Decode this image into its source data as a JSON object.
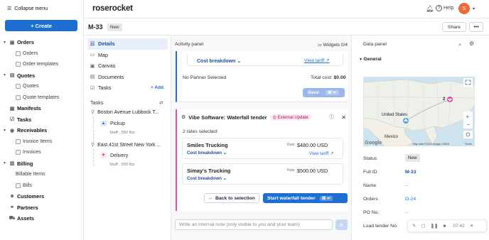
{
  "sidebar": {
    "collapse_label": "Collapse menu",
    "create_label": "+ Create",
    "groups": [
      {
        "label": "Orders",
        "items": [
          "Orders",
          "Order templates"
        ]
      },
      {
        "label": "Quotes",
        "items": [
          "Quotes",
          "Quote templates"
        ]
      },
      {
        "label": "Manifests",
        "items": []
      },
      {
        "label": "Tasks",
        "items": []
      },
      {
        "label": "Receivables",
        "items": [
          "Invoice Items",
          "Invoices"
        ]
      },
      {
        "label": "Billing",
        "items": [
          "Billable Items",
          "Bills"
        ]
      },
      {
        "label": "Customers",
        "items": []
      },
      {
        "label": "Partners",
        "items": []
      },
      {
        "label": "Assets",
        "items": []
      }
    ]
  },
  "topbar": {
    "logo": "roserocket",
    "help": "Help",
    "avatar_initial": "S",
    "accent": "#f06a36"
  },
  "header": {
    "order_id": "M-33",
    "status": "New",
    "share": "Share",
    "more": "•••"
  },
  "left_nav": {
    "items": [
      "Details",
      "Map",
      "Canvas",
      "Documents",
      "Tasks"
    ],
    "add_label": "+ Add",
    "tasks_heading": "Tasks",
    "stops": [
      {
        "name": "Boston Avenue Lubbock T...",
        "action": "Pickup",
        "sub": "Stuff , 550 lbs"
      },
      {
        "name": "East 41st Street New York ...",
        "action": "Delivery",
        "sub": "Stuff , 550 lbs"
      }
    ]
  },
  "activity": {
    "title": "Activity panel",
    "widgets": "Widgets 0/4",
    "cost_breakdown": "Cost breakdown",
    "view_tariff": "View tariff",
    "no_partner": "No Partner Selected",
    "total_cost_label": "Total cost:",
    "total_cost_value": "$0.00",
    "save": "Save",
    "shortcut": "⌘ ↵"
  },
  "tender": {
    "title": "Vibe Software: Waterfall tender",
    "badge": "External Update",
    "selected": "2 rates selected:",
    "rates": [
      {
        "name": "Smiles Trucking",
        "rate_label": "Rate",
        "rate": "$480.00 USD",
        "breakdown": "Cost breakdown",
        "tariff": "View tariff"
      },
      {
        "name": "Simay's Trucking",
        "rate_label": "Rate",
        "rate": "$500.00 USD",
        "breakdown": "Cost breakdown",
        "tariff": ""
      }
    ],
    "back": "Back to selection",
    "start": "Start waterfall tender",
    "shortcut": "⌘ ↵"
  },
  "note": {
    "placeholder": "Write an internal note (only visible to you and your team)"
  },
  "data_panel": {
    "title": "Data panel",
    "section": "General",
    "map": {
      "label_us": "United States",
      "label_mx": "Mexico",
      "attribution": "Map data ©2024 Google, INEGI",
      "terms": "Terms",
      "google": "Google",
      "cluster": "2"
    },
    "fields": [
      {
        "label": "Status",
        "value": "New"
      },
      {
        "label": "Full ID",
        "value": "M-33"
      },
      {
        "label": "Name",
        "value": "--"
      },
      {
        "label": "Orders",
        "value": "O-24"
      },
      {
        "label": "PO No.",
        "value": "--"
      },
      {
        "label": "Load tender No.",
        "value": ""
      }
    ]
  },
  "recorder": {
    "time": "07:42"
  }
}
